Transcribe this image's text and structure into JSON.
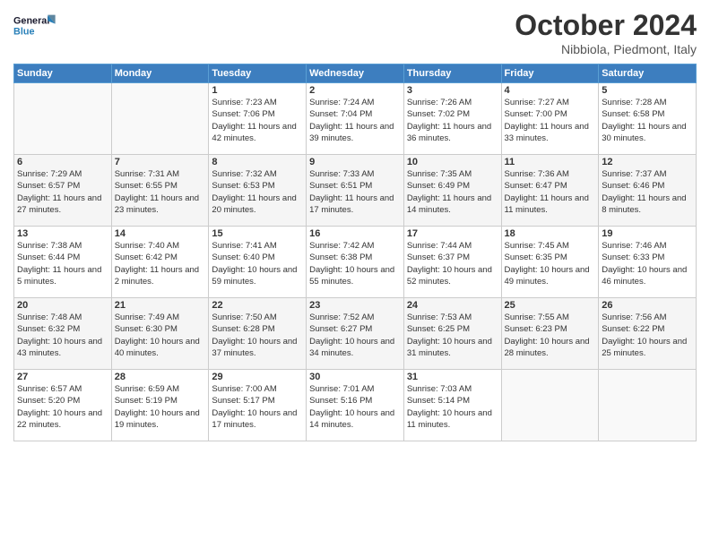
{
  "header": {
    "logo_line1": "General",
    "logo_line2": "Blue",
    "title": "October 2024",
    "location": "Nibbiola, Piedmont, Italy"
  },
  "weekdays": [
    "Sunday",
    "Monday",
    "Tuesday",
    "Wednesday",
    "Thursday",
    "Friday",
    "Saturday"
  ],
  "weeks": [
    [
      {
        "day": "",
        "sunrise": "",
        "sunset": "",
        "daylight": ""
      },
      {
        "day": "",
        "sunrise": "",
        "sunset": "",
        "daylight": ""
      },
      {
        "day": "1",
        "sunrise": "Sunrise: 7:23 AM",
        "sunset": "Sunset: 7:06 PM",
        "daylight": "Daylight: 11 hours and 42 minutes."
      },
      {
        "day": "2",
        "sunrise": "Sunrise: 7:24 AM",
        "sunset": "Sunset: 7:04 PM",
        "daylight": "Daylight: 11 hours and 39 minutes."
      },
      {
        "day": "3",
        "sunrise": "Sunrise: 7:26 AM",
        "sunset": "Sunset: 7:02 PM",
        "daylight": "Daylight: 11 hours and 36 minutes."
      },
      {
        "day": "4",
        "sunrise": "Sunrise: 7:27 AM",
        "sunset": "Sunset: 7:00 PM",
        "daylight": "Daylight: 11 hours and 33 minutes."
      },
      {
        "day": "5",
        "sunrise": "Sunrise: 7:28 AM",
        "sunset": "Sunset: 6:58 PM",
        "daylight": "Daylight: 11 hours and 30 minutes."
      }
    ],
    [
      {
        "day": "6",
        "sunrise": "Sunrise: 7:29 AM",
        "sunset": "Sunset: 6:57 PM",
        "daylight": "Daylight: 11 hours and 27 minutes."
      },
      {
        "day": "7",
        "sunrise": "Sunrise: 7:31 AM",
        "sunset": "Sunset: 6:55 PM",
        "daylight": "Daylight: 11 hours and 23 minutes."
      },
      {
        "day": "8",
        "sunrise": "Sunrise: 7:32 AM",
        "sunset": "Sunset: 6:53 PM",
        "daylight": "Daylight: 11 hours and 20 minutes."
      },
      {
        "day": "9",
        "sunrise": "Sunrise: 7:33 AM",
        "sunset": "Sunset: 6:51 PM",
        "daylight": "Daylight: 11 hours and 17 minutes."
      },
      {
        "day": "10",
        "sunrise": "Sunrise: 7:35 AM",
        "sunset": "Sunset: 6:49 PM",
        "daylight": "Daylight: 11 hours and 14 minutes."
      },
      {
        "day": "11",
        "sunrise": "Sunrise: 7:36 AM",
        "sunset": "Sunset: 6:47 PM",
        "daylight": "Daylight: 11 hours and 11 minutes."
      },
      {
        "day": "12",
        "sunrise": "Sunrise: 7:37 AM",
        "sunset": "Sunset: 6:46 PM",
        "daylight": "Daylight: 11 hours and 8 minutes."
      }
    ],
    [
      {
        "day": "13",
        "sunrise": "Sunrise: 7:38 AM",
        "sunset": "Sunset: 6:44 PM",
        "daylight": "Daylight: 11 hours and 5 minutes."
      },
      {
        "day": "14",
        "sunrise": "Sunrise: 7:40 AM",
        "sunset": "Sunset: 6:42 PM",
        "daylight": "Daylight: 11 hours and 2 minutes."
      },
      {
        "day": "15",
        "sunrise": "Sunrise: 7:41 AM",
        "sunset": "Sunset: 6:40 PM",
        "daylight": "Daylight: 10 hours and 59 minutes."
      },
      {
        "day": "16",
        "sunrise": "Sunrise: 7:42 AM",
        "sunset": "Sunset: 6:38 PM",
        "daylight": "Daylight: 10 hours and 55 minutes."
      },
      {
        "day": "17",
        "sunrise": "Sunrise: 7:44 AM",
        "sunset": "Sunset: 6:37 PM",
        "daylight": "Daylight: 10 hours and 52 minutes."
      },
      {
        "day": "18",
        "sunrise": "Sunrise: 7:45 AM",
        "sunset": "Sunset: 6:35 PM",
        "daylight": "Daylight: 10 hours and 49 minutes."
      },
      {
        "day": "19",
        "sunrise": "Sunrise: 7:46 AM",
        "sunset": "Sunset: 6:33 PM",
        "daylight": "Daylight: 10 hours and 46 minutes."
      }
    ],
    [
      {
        "day": "20",
        "sunrise": "Sunrise: 7:48 AM",
        "sunset": "Sunset: 6:32 PM",
        "daylight": "Daylight: 10 hours and 43 minutes."
      },
      {
        "day": "21",
        "sunrise": "Sunrise: 7:49 AM",
        "sunset": "Sunset: 6:30 PM",
        "daylight": "Daylight: 10 hours and 40 minutes."
      },
      {
        "day": "22",
        "sunrise": "Sunrise: 7:50 AM",
        "sunset": "Sunset: 6:28 PM",
        "daylight": "Daylight: 10 hours and 37 minutes."
      },
      {
        "day": "23",
        "sunrise": "Sunrise: 7:52 AM",
        "sunset": "Sunset: 6:27 PM",
        "daylight": "Daylight: 10 hours and 34 minutes."
      },
      {
        "day": "24",
        "sunrise": "Sunrise: 7:53 AM",
        "sunset": "Sunset: 6:25 PM",
        "daylight": "Daylight: 10 hours and 31 minutes."
      },
      {
        "day": "25",
        "sunrise": "Sunrise: 7:55 AM",
        "sunset": "Sunset: 6:23 PM",
        "daylight": "Daylight: 10 hours and 28 minutes."
      },
      {
        "day": "26",
        "sunrise": "Sunrise: 7:56 AM",
        "sunset": "Sunset: 6:22 PM",
        "daylight": "Daylight: 10 hours and 25 minutes."
      }
    ],
    [
      {
        "day": "27",
        "sunrise": "Sunrise: 6:57 AM",
        "sunset": "Sunset: 5:20 PM",
        "daylight": "Daylight: 10 hours and 22 minutes."
      },
      {
        "day": "28",
        "sunrise": "Sunrise: 6:59 AM",
        "sunset": "Sunset: 5:19 PM",
        "daylight": "Daylight: 10 hours and 19 minutes."
      },
      {
        "day": "29",
        "sunrise": "Sunrise: 7:00 AM",
        "sunset": "Sunset: 5:17 PM",
        "daylight": "Daylight: 10 hours and 17 minutes."
      },
      {
        "day": "30",
        "sunrise": "Sunrise: 7:01 AM",
        "sunset": "Sunset: 5:16 PM",
        "daylight": "Daylight: 10 hours and 14 minutes."
      },
      {
        "day": "31",
        "sunrise": "Sunrise: 7:03 AM",
        "sunset": "Sunset: 5:14 PM",
        "daylight": "Daylight: 10 hours and 11 minutes."
      },
      {
        "day": "",
        "sunrise": "",
        "sunset": "",
        "daylight": ""
      },
      {
        "day": "",
        "sunrise": "",
        "sunset": "",
        "daylight": ""
      }
    ]
  ]
}
